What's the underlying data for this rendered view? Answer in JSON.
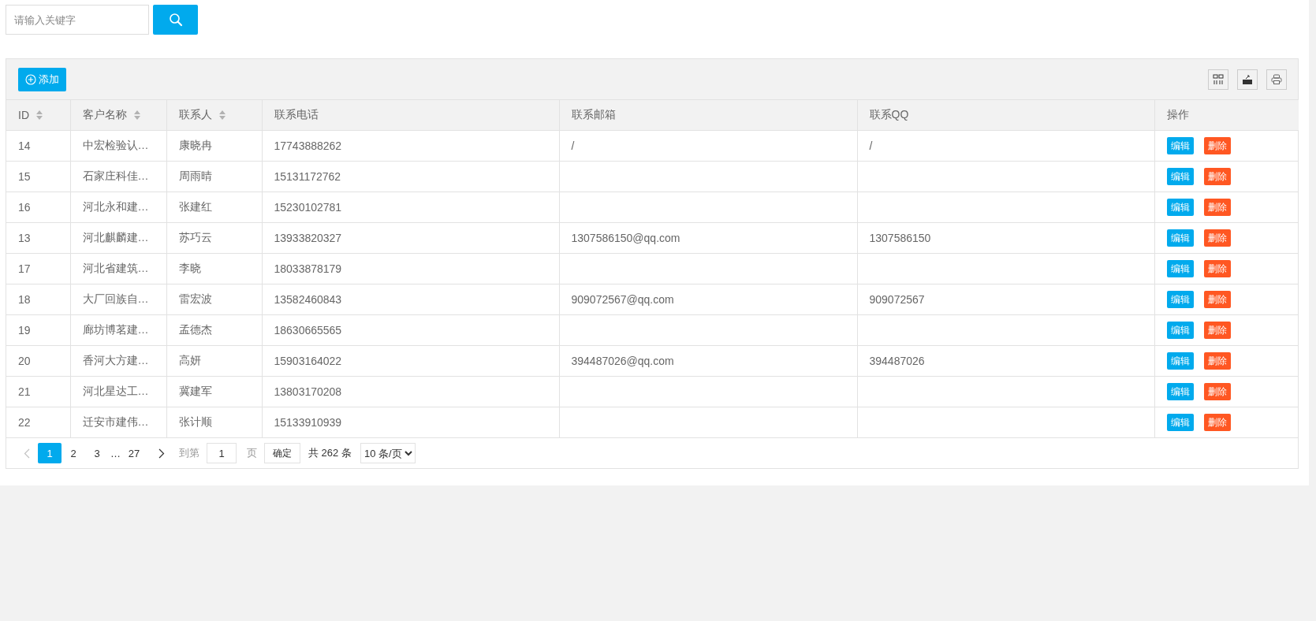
{
  "search": {
    "placeholder": "请输入关键字"
  },
  "toolbar": {
    "add_button": "添加"
  },
  "table": {
    "columns": [
      {
        "label": "ID",
        "sortable": true
      },
      {
        "label": "客户名称",
        "sortable": true
      },
      {
        "label": "联系人",
        "sortable": true
      },
      {
        "label": "联系电话",
        "sortable": false
      },
      {
        "label": "联系邮箱",
        "sortable": false
      },
      {
        "label": "联系QQ",
        "sortable": false
      },
      {
        "label": "操作",
        "sortable": false
      }
    ],
    "rows": [
      {
        "id": "14",
        "name": "中宏检验认…",
        "contact": "康晓冉",
        "phone": "17743888262",
        "email": "/",
        "qq": "/"
      },
      {
        "id": "15",
        "name": "石家庄科佳…",
        "contact": "周雨晴",
        "phone": "15131172762",
        "email": "",
        "qq": ""
      },
      {
        "id": "16",
        "name": "河北永和建…",
        "contact": "张建红",
        "phone": "15230102781",
        "email": "",
        "qq": ""
      },
      {
        "id": "13",
        "name": "河北麒麟建…",
        "contact": "苏巧云",
        "phone": "13933820327",
        "email": "1307586150@qq.com",
        "qq": "1307586150"
      },
      {
        "id": "17",
        "name": "河北省建筑…",
        "contact": "李晓",
        "phone": "18033878179",
        "email": "",
        "qq": ""
      },
      {
        "id": "18",
        "name": "大厂回族自…",
        "contact": "雷宏波",
        "phone": "13582460843",
        "email": "909072567@qq.com",
        "qq": "909072567"
      },
      {
        "id": "19",
        "name": "廊坊博茗建…",
        "contact": "孟德杰",
        "phone": "18630665565",
        "email": "",
        "qq": ""
      },
      {
        "id": "20",
        "name": "香河大方建…",
        "contact": "高妍",
        "phone": "15903164022",
        "email": "394487026@qq.com",
        "qq": "394487026"
      },
      {
        "id": "21",
        "name": "河北星达工…",
        "contact": "冀建军",
        "phone": "13803170208",
        "email": "",
        "qq": ""
      },
      {
        "id": "22",
        "name": "迁安市建伟…",
        "contact": "张计顺",
        "phone": "15133910939",
        "email": "",
        "qq": ""
      }
    ],
    "row_actions": [
      {
        "edit": "编辑",
        "delete": "删除"
      },
      {
        "edit": "编辑",
        "delete": "删除"
      },
      {
        "edit": "编辑",
        "delete": "删除"
      },
      {
        "edit": "编辑",
        "delete": "删除"
      },
      {
        "edit": "编辑",
        "delete": "删除"
      },
      {
        "edit": "编辑",
        "delete": "删除"
      },
      {
        "edit": "编辑",
        "delete": "删除"
      },
      {
        "edit": "编辑",
        "delete": "删除"
      },
      {
        "edit": "编辑",
        "delete": "删除"
      },
      {
        "edit": "编辑",
        "delete": "删除"
      }
    ]
  },
  "pagination": {
    "prev_disabled": true,
    "pages": [
      {
        "label": "1",
        "selected": true
      },
      {
        "label": "2",
        "selected": false
      },
      {
        "label": "3",
        "selected": false
      },
      {
        "label": "…",
        "kind": "ellipsis"
      },
      {
        "label": "27",
        "selected": false
      }
    ],
    "goto_label": "到第",
    "goto_value": "1",
    "page_unit": "页",
    "confirm": "确定",
    "total": "共 262 条",
    "page_size": "10 条/页"
  }
}
